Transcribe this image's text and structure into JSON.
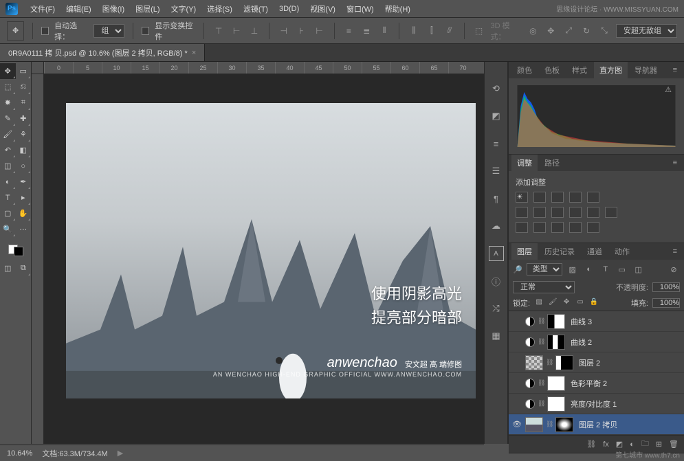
{
  "menu": {
    "items": [
      "文件(F)",
      "编辑(E)",
      "图像(I)",
      "图层(L)",
      "文字(Y)",
      "选择(S)",
      "滤镜(T)",
      "3D(D)",
      "视图(V)",
      "窗口(W)",
      "帮助(H)"
    ],
    "brand": "思缘设计论坛 · WWW.MISSYUAN.COM"
  },
  "options": {
    "auto_select": "自动选择：",
    "group": "组",
    "show_transform": "显示变换控件",
    "mode3d": "3D 模式：",
    "preset": "安超无敌组"
  },
  "doc": {
    "title": "0R9A0111 拷 贝.psd @ 10.6% (图层 2 拷贝, RGB/8) *"
  },
  "ruler_h": [
    "0",
    "5",
    "10",
    "15",
    "20",
    "25",
    "30",
    "35",
    "40",
    "45",
    "50",
    "55",
    "60",
    "65",
    "70"
  ],
  "canvas_overlay": {
    "line1": "使用阴影高光",
    "line2": "提亮部分暗部",
    "wm": "anwenchao",
    "wm_sub1": "安文超 高 端修图",
    "wm_sub2": "AN WENCHAO HIGH-END GRAPHIC OFFICIAL   WWW.ANWENCHAO.COM"
  },
  "panels": {
    "color_tabs": [
      "颜色",
      "色板",
      "样式",
      "直方图",
      "导航器"
    ],
    "adjust_tabs": [
      "调整",
      "路径"
    ],
    "adjust_label": "添加调整",
    "layer_tabs": [
      "图层",
      "历史记录",
      "通道",
      "动作"
    ],
    "layer_filter": "类型",
    "blend_mode": "正常",
    "opacity_label": "不透明度:",
    "opacity_val": "100%",
    "lock_label": "锁定:",
    "fill_label": "填充:",
    "fill_val": "100%",
    "layers": [
      {
        "name": "曲线 3",
        "eye": "",
        "adj": true,
        "mask": "bw"
      },
      {
        "name": "曲线 2",
        "eye": "",
        "adj": true,
        "mask": "bw"
      },
      {
        "name": "图层 2",
        "eye": "",
        "adj": false,
        "mask": "bw",
        "checker": true
      },
      {
        "name": "色彩平衡 2",
        "eye": "",
        "adj": true,
        "mask": "white"
      },
      {
        "name": "亮度/对比度 1",
        "eye": "",
        "adj": true,
        "mask": "white"
      },
      {
        "name": "图层 2 拷贝",
        "eye": "👁",
        "adj": false,
        "mask": "bw",
        "sel": true,
        "img": true
      }
    ]
  },
  "status": {
    "zoom": "10.64%",
    "doc": "文档:63.3M/734.4M"
  },
  "footer_wm": "第七城市   www.th7.cn"
}
